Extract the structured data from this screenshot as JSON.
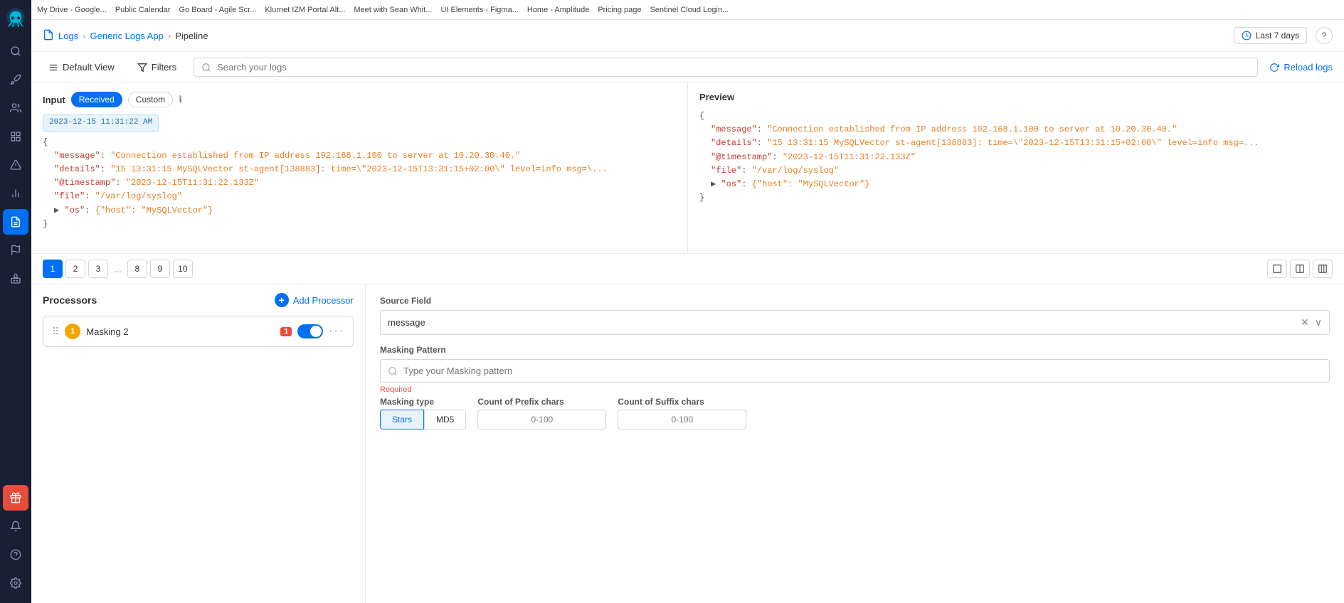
{
  "sidebar": {
    "logo": "🐙",
    "items": [
      {
        "id": "search",
        "icon": "🔍",
        "active": false
      },
      {
        "id": "rocket",
        "icon": "🚀",
        "active": false
      },
      {
        "id": "users",
        "icon": "👤",
        "active": false
      },
      {
        "id": "grid",
        "icon": "⊞",
        "active": false
      },
      {
        "id": "alert",
        "icon": "⚠",
        "active": false
      },
      {
        "id": "chart",
        "icon": "📊",
        "active": false
      },
      {
        "id": "logs",
        "icon": "📄",
        "active": true
      },
      {
        "id": "flag",
        "icon": "🚩",
        "active": false
      },
      {
        "id": "robot",
        "icon": "🤖",
        "active": false
      },
      {
        "id": "gift",
        "icon": "🎁",
        "active": false,
        "notification": true
      },
      {
        "id": "bell",
        "icon": "🔔",
        "active": false
      },
      {
        "id": "help",
        "icon": "❓",
        "active": false
      },
      {
        "id": "settings",
        "icon": "⚙",
        "active": false
      }
    ]
  },
  "topbar": {
    "items": [
      "My Drive - Google...",
      "Public Calendar",
      "Go Board - Agile Scr...",
      "Klurnet IZM Portal Alt...",
      "Meet with Sean Whit...",
      "UI Elements - Figma...",
      "Home - Amplitude",
      "Pricing page",
      "Sentinel Cloud Login..."
    ]
  },
  "header": {
    "breadcrumb": {
      "icon": "📄",
      "logs_label": "Logs",
      "app_label": "Generic Logs App",
      "current": "Pipeline"
    },
    "time_range": "Last 7 days",
    "help_label": "?"
  },
  "toolbar": {
    "default_view_label": "Default View",
    "filters_label": "Filters",
    "search_placeholder": "Search your logs",
    "reload_label": "Reload logs"
  },
  "input_panel": {
    "title": "Input",
    "tab_received": "Received",
    "tab_custom": "Custom",
    "log_timestamp": "2023-12-15 11:31:22 AM",
    "log_lines": [
      {
        "indent": 0,
        "text": "{"
      },
      {
        "indent": 1,
        "key": "\"message\"",
        "value": "\"Connection established from IP address 192.168.1.100 to server at 10.20.30.40.\""
      },
      {
        "indent": 1,
        "key": "\"details\"",
        "value": "\"15 13:31:15 MySQLVector st-agent[138883]: time=\\\"2023-12-15T13:31:15+02:00\\\" level=info msg=..."
      },
      {
        "indent": 1,
        "key": "\"@timestamp\"",
        "value": "\"2023-12-15T11:31:22.133Z\""
      },
      {
        "indent": 1,
        "key": "\"file\"",
        "value": "\"/var/log/syslog\""
      },
      {
        "indent": 1,
        "key": "▶ \"os\"",
        "value": "{\"host\": \"MySQLVector\"}"
      },
      {
        "indent": 0,
        "text": "}"
      }
    ]
  },
  "preview_panel": {
    "title": "Preview",
    "log_lines": [
      {
        "indent": 0,
        "text": "{"
      },
      {
        "indent": 1,
        "key": "\"message\"",
        "value": "\"Connection established from IP address 192.168.1.100 to server at 10.20.30.40.\""
      },
      {
        "indent": 1,
        "key": "\"details\"",
        "value": "\"15 13:31:15 MySQLVector st-agent[138883]: time=\\\"2023-12-15T13:31:15+02:00\\\" level=info msg=..."
      },
      {
        "indent": 1,
        "key": "\"@timestamp\"",
        "value": "\"2023-12-15T11:31:22.133Z\""
      },
      {
        "indent": 1,
        "key": "\"file\"",
        "value": "\"/var/log/syslog\""
      },
      {
        "indent": 1,
        "key": "▶ \"os\"",
        "value": "{\"host\": \"MySQLVector\"}"
      },
      {
        "indent": 0,
        "text": "}"
      }
    ]
  },
  "pagination": {
    "pages": [
      "1",
      "2",
      "3",
      "...",
      "8",
      "9",
      "10"
    ],
    "active_page": "1"
  },
  "processors": {
    "title": "Processors",
    "add_label": "Add Processor",
    "items": [
      {
        "number": "1",
        "name": "Masking 2",
        "badge": "1",
        "enabled": true
      }
    ]
  },
  "config": {
    "source_field_label": "Source Field",
    "source_field_value": "message",
    "masking_pattern_label": "Masking Pattern",
    "masking_pattern_placeholder": "Type your Masking pattern",
    "required_text": "Required",
    "masking_type_label": "Masking type",
    "masking_type_stars": "Stars",
    "masking_type_md5": "MD5",
    "prefix_label": "Count of Prefix chars",
    "prefix_placeholder": "0-100",
    "suffix_label": "Count of Suffix chars",
    "suffix_placeholder": "0-100"
  },
  "colors": {
    "primary": "#0070f3",
    "danger": "#e74c3c",
    "warning": "#f0a500",
    "sidebar_bg": "#1a1f36"
  }
}
